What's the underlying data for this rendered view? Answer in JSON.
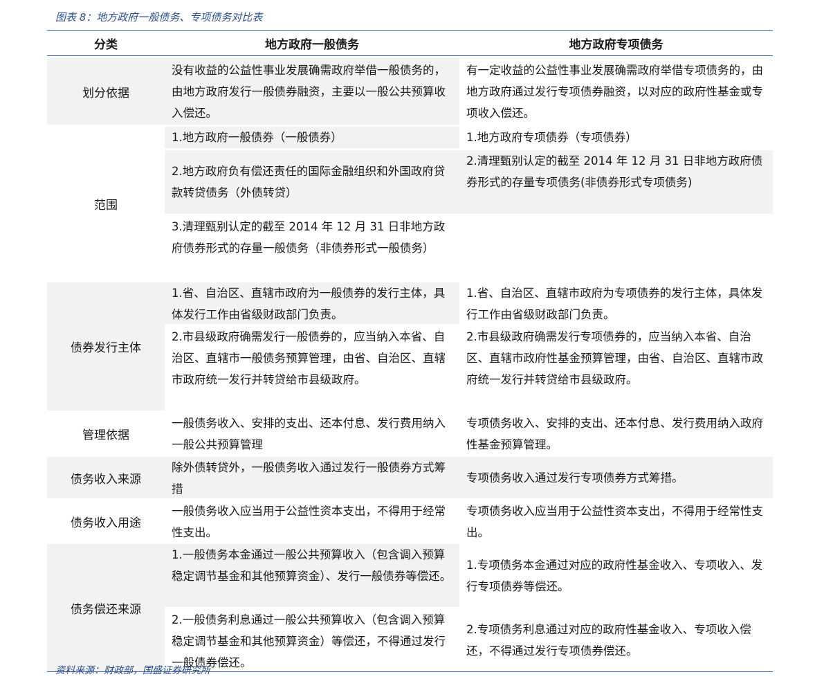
{
  "caption": "图表 8：地方政府一般债务、专项债务对比表",
  "source": "资料来源：财政部，国盛证券研究所",
  "headers": [
    "分类",
    "地方政府一般债务",
    "地方政府专项债务"
  ],
  "groups": [
    {
      "category": "划分依据",
      "rows": [
        {
          "general": "没有收益的公益性事业发展确需政府举借一般债务的，由地方政府发行一般债券融资，主要以一般公共预算收入偿还。",
          "special": "有一定收益的公益性事业发展确需政府举借专项债务的，由地方政府通过发行专项债券融资，以对应的政府性基金或专项收入偿还。"
        }
      ]
    },
    {
      "category": "范围",
      "rows": [
        {
          "general": "1.地方政府一般债券（一般债券）",
          "special": "1.地方政府专项债券（专项债券）"
        },
        {
          "general": "2.地方政府负有偿还责任的国际金融组织和外国政府贷款转贷债务（外债转贷）",
          "special": "2.清理甄别认定的截至 2014 年 12 月 31 日非地方政府债券形式的存量专项债务(非债券形式专项债务)"
        },
        {
          "general": "3.清理甄别认定的截至 2014 年 12 月 31 日非地方政府债券形式的存量一般债务（非债券形式一般债务）",
          "special": ""
        }
      ]
    },
    {
      "category": "债券发行主体",
      "rows": [
        {
          "general": "1.省、自治区、直辖市政府为一般债券的发行主体，具体发行工作由省级财政部门负责。",
          "special": "1.省、自治区、直辖市政府为专项债券的发行主体，具体发行工作由省级财政部门负责。"
        },
        {
          "general": "2.市县级政府确需发行一般债券的，应当纳入本省、自治区、直辖市一般债务预算管理，由省、自治区、直辖市政府统一发行并转贷给市县级政府。",
          "special": "2.市县级政府确需发行专项债券的，应当纳入本省、自治区、直辖市政府性基金预算管理，由省、自治区、直辖市政府统一发行并转贷给市县级政府。"
        }
      ]
    },
    {
      "category": "管理依据",
      "rows": [
        {
          "general": "一般债务收入、安排的支出、还本付息、发行费用纳入一般公共预算管理",
          "special": "专项债务收入、安排的支出、还本付息、发行费用纳入政府性基金预算管理。"
        }
      ]
    },
    {
      "category": "债务收入来源",
      "rows": [
        {
          "general": "除外债转贷外，一般债务收入通过发行一般债券方式筹措",
          "special": "专项债务收入通过发行专项债券方式筹措。"
        }
      ]
    },
    {
      "category": "债务收入用途",
      "rows": [
        {
          "general": "一般债务收入应当用于公益性资本支出，不得用于经常性支出。",
          "special": "专项债务收入应当用于公益性资本支出，不得用于经常性支出。"
        }
      ]
    },
    {
      "category": "债务偿还来源",
      "rows": [
        {
          "general": "1.一般债务本金通过一般公共预算收入（包含调入预算稳定调节基金和其他预算资金）、发行一般债券等偿还。",
          "special": "1.专项债务本金通过对应的政府性基金收入、专项收入、发行专项债券等偿还。"
        },
        {
          "general": "2.一般债务利息通过一般公共预算收入（包含调入预算稳定调节基金和其他预算资金）等偿还，不得通过发行一般债券偿还。",
          "special": "2.专项债务利息通过对应的政府性基金收入、专项收入偿还，不得通过发行专项债券偿还。"
        }
      ]
    }
  ]
}
